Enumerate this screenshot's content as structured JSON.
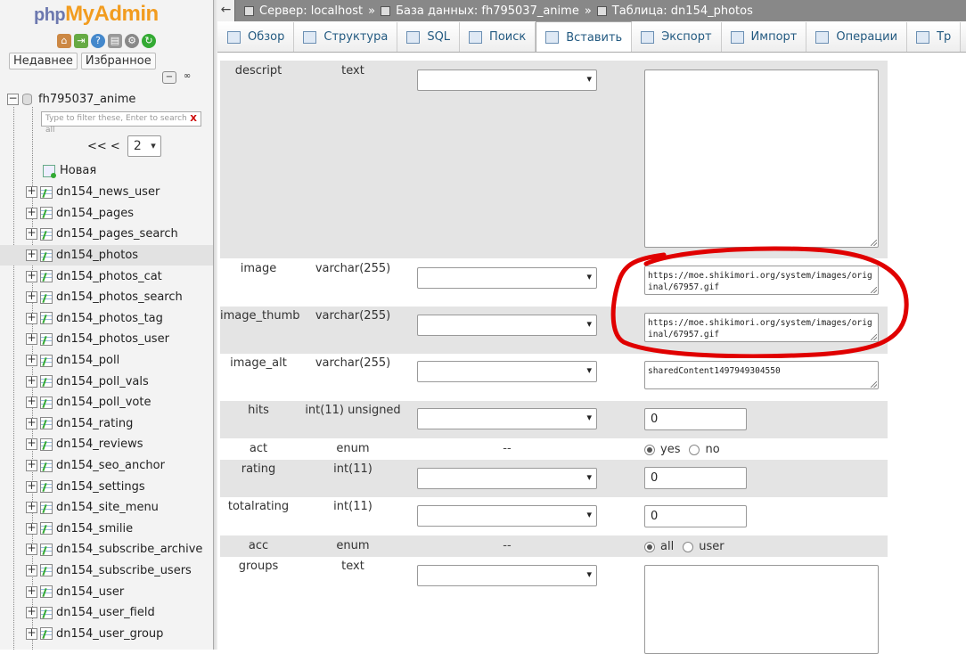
{
  "app": {
    "logo_php": "php",
    "logo_myadmin": "MyAdmin"
  },
  "sidebar": {
    "recent_label": "Недавнее",
    "favorites_label": "Избранное",
    "database": "fh795037_anime",
    "filter_placeholder": "Type to filter these, Enter to search all",
    "filter_clear": "X",
    "pager_prev": "<< <",
    "pager_page": "2",
    "new_label": "Новая",
    "tables": [
      "dn154_news_user",
      "dn154_pages",
      "dn154_pages_search",
      "dn154_photos",
      "dn154_photos_cat",
      "dn154_photos_search",
      "dn154_photos_tag",
      "dn154_photos_user",
      "dn154_poll",
      "dn154_poll_vals",
      "dn154_poll_vote",
      "dn154_rating",
      "dn154_reviews",
      "dn154_seo_anchor",
      "dn154_settings",
      "dn154_site_menu",
      "dn154_smilie",
      "dn154_subscribe_archive",
      "dn154_subscribe_users",
      "dn154_user",
      "dn154_user_field",
      "dn154_user_group"
    ],
    "active_table": "dn154_photos"
  },
  "breadcrumb": {
    "server": "Сервер: localhost",
    "database": "База данных: fh795037_anime",
    "table": "Таблица: dn154_photos",
    "separator": "»"
  },
  "tabs": [
    {
      "label": "Обзор",
      "icon": "browse-icon"
    },
    {
      "label": "Структура",
      "icon": "structure-icon"
    },
    {
      "label": "SQL",
      "icon": "sql-icon"
    },
    {
      "label": "Поиск",
      "icon": "search-icon"
    },
    {
      "label": "Вставить",
      "icon": "insert-icon",
      "active": true
    },
    {
      "label": "Экспорт",
      "icon": "export-icon"
    },
    {
      "label": "Импорт",
      "icon": "import-icon"
    },
    {
      "label": "Операции",
      "icon": "operations-icon"
    },
    {
      "label": "Тр",
      "icon": "triggers-icon"
    }
  ],
  "fields": [
    {
      "name": "descript",
      "type": "text",
      "value": ""
    },
    {
      "name": "image",
      "type": "varchar(255)",
      "value": "https://moe.shikimori.org/system/images/original/67957.gif"
    },
    {
      "name": "image_thumb",
      "type": "varchar(255)",
      "value": "https://moe.shikimori.org/system/images/original/67957.gif"
    },
    {
      "name": "image_alt",
      "type": "varchar(255)",
      "value": "sharedContent1497949304550"
    },
    {
      "name": "hits",
      "type": "int(11) unsigned",
      "value": "0"
    },
    {
      "name": "act",
      "type": "enum",
      "func": "--",
      "options": [
        "yes",
        "no"
      ],
      "selected": "yes"
    },
    {
      "name": "rating",
      "type": "int(11)",
      "value": "0"
    },
    {
      "name": "totalrating",
      "type": "int(11)",
      "value": "0"
    },
    {
      "name": "acc",
      "type": "enum",
      "func": "--",
      "options": [
        "all",
        "user"
      ],
      "selected": "all"
    },
    {
      "name": "groups",
      "type": "text",
      "value": ""
    }
  ],
  "colors": {
    "annotation": "#e00000",
    "tab_text": "#235a81",
    "row_shade": "#e4e4e4"
  }
}
